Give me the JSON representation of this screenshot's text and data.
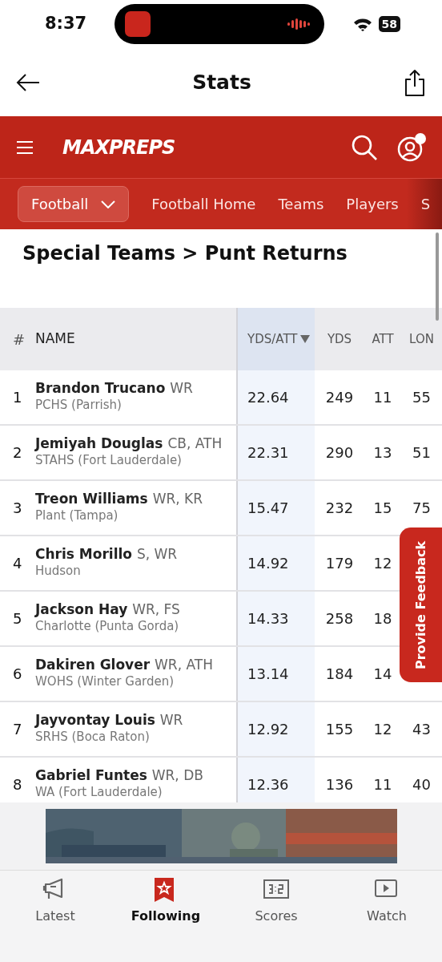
{
  "status_bar": {
    "time": "8:37",
    "battery": "58"
  },
  "header": {
    "title": "Stats"
  },
  "brand": {
    "logo": "MAXPREPS"
  },
  "sport_menu": {
    "label": "Football"
  },
  "subnav": [
    {
      "label": "Football Home"
    },
    {
      "label": "Teams"
    },
    {
      "label": "Players"
    },
    {
      "label": "S"
    }
  ],
  "page_title": "Special Teams > Punt Returns",
  "table": {
    "columns": [
      {
        "label": "#",
        "sorted": false
      },
      {
        "label": "NAME",
        "sorted": false
      },
      {
        "label": "YDS/ATT",
        "sorted": true
      },
      {
        "label": "YDS",
        "sorted": false
      },
      {
        "label": "ATT",
        "sorted": false
      },
      {
        "label": "LON",
        "sorted": false
      }
    ],
    "rows": [
      {
        "rank": "1",
        "name": "Brandon Trucano",
        "position": "WR",
        "school": "PCHS (Parrish)",
        "yds_att": "22.64",
        "yds": "249",
        "att": "11",
        "long": "55"
      },
      {
        "rank": "2",
        "name": "Jemiyah Douglas",
        "position": "CB, ATH",
        "school": "STAHS (Fort Lauderdale)",
        "yds_att": "22.31",
        "yds": "290",
        "att": "13",
        "long": "51"
      },
      {
        "rank": "3",
        "name": "Treon Williams",
        "position": "WR, KR",
        "school": "Plant (Tampa)",
        "yds_att": "15.47",
        "yds": "232",
        "att": "15",
        "long": "75"
      },
      {
        "rank": "4",
        "name": "Chris Morillo",
        "position": "S, WR",
        "school": "Hudson",
        "yds_att": "14.92",
        "yds": "179",
        "att": "12"
      },
      {
        "rank": "5",
        "name": "Jackson Hay",
        "position": "WR, FS",
        "school": "Charlotte (Punta Gorda)",
        "yds_att": "14.33",
        "yds": "258",
        "att": "18"
      },
      {
        "rank": "6",
        "name": "Dakiren Glover",
        "position": "WR, ATH",
        "school": "WOHS (Winter Garden)",
        "yds_att": "13.14",
        "yds": "184",
        "att": "14"
      },
      {
        "rank": "7",
        "name": "Jayvontay Louis",
        "position": "WR",
        "school": "SRHS (Boca Raton)",
        "yds_att": "12.92",
        "yds": "155",
        "att": "12",
        "long": "43"
      },
      {
        "rank": "8",
        "name": "Gabriel Funtes",
        "position": "WR, DB",
        "school": "WA (Fort Lauderdale)",
        "yds_att": "12.36",
        "yds": "136",
        "att": "11",
        "long": "40"
      }
    ]
  },
  "feedback_tab": {
    "label": "Provide Feedback"
  },
  "tab_bar": [
    {
      "label": "Latest",
      "kind": "megaphone",
      "selected": false
    },
    {
      "label": "Following",
      "kind": "bookmark",
      "selected": true
    },
    {
      "label": "Scores",
      "kind": "scoreboard",
      "selected": false
    },
    {
      "label": "Watch",
      "kind": "play",
      "selected": false
    }
  ]
}
